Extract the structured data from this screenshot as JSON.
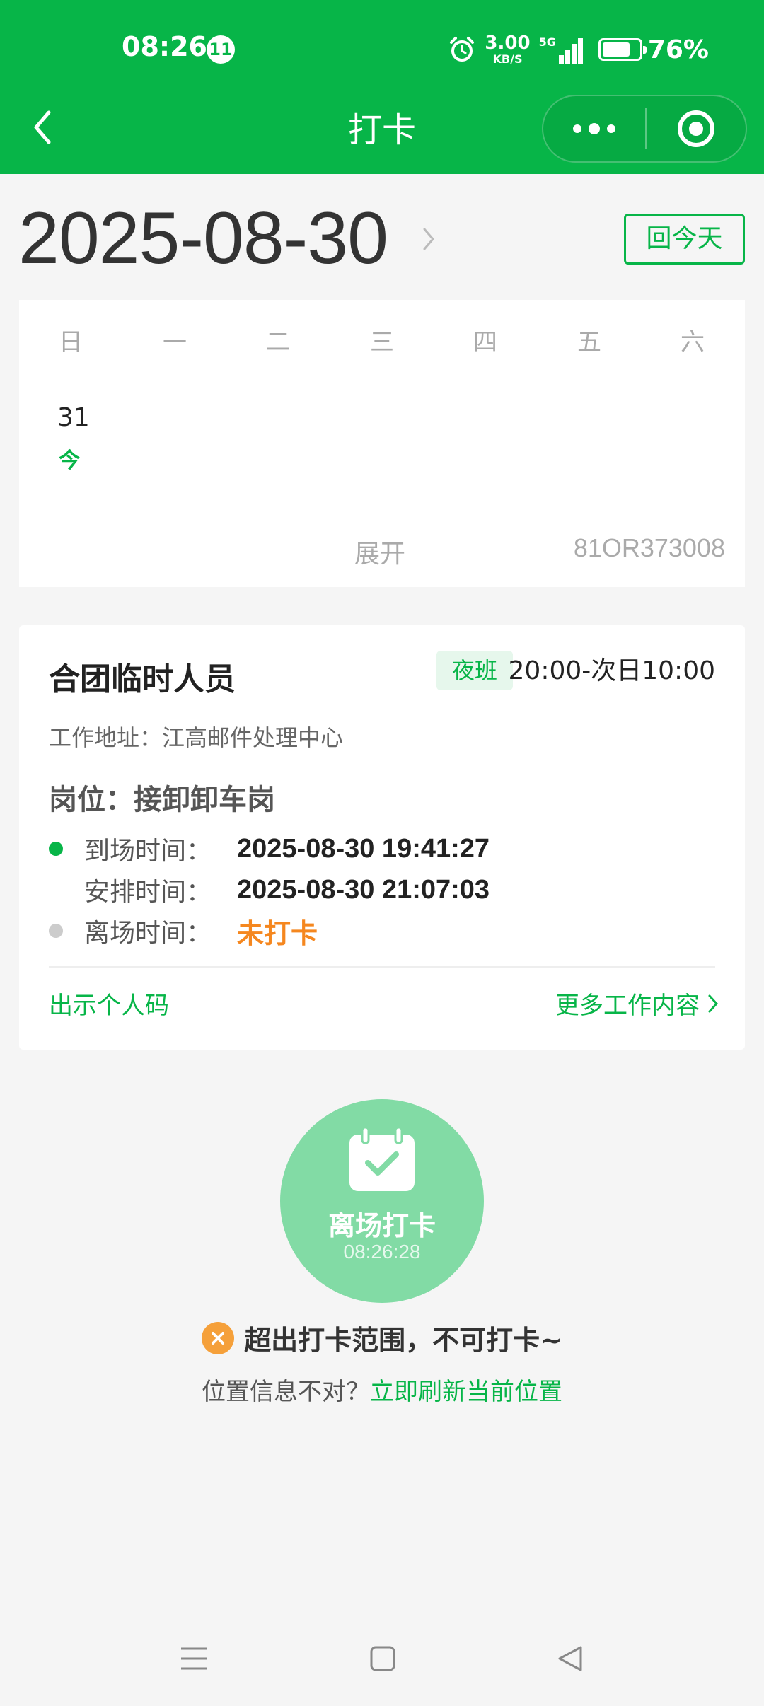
{
  "status_bar": {
    "time": "08:26",
    "notification_count": "11",
    "net_speed_value": "3.00",
    "net_speed_unit": "KB/S",
    "network_type": "5G",
    "battery_percent": "76%",
    "battery_level": 0.76
  },
  "nav": {
    "title": "打卡"
  },
  "date_header": {
    "date": "2025-08-30",
    "today_button": "回今天"
  },
  "calendar": {
    "weekdays": [
      "日",
      "一",
      "二",
      "三",
      "四",
      "五",
      "六"
    ],
    "day_number": "31",
    "today_label": "今",
    "expand_label": "展开",
    "station_code": "81OR373008"
  },
  "work_card": {
    "title": "合团临时人员",
    "shift_tag": "夜班",
    "shift_time": "20:00-次日10:00",
    "address": "工作地址：江高邮件处理中心",
    "position": "岗位：接卸卸车岗",
    "arrival_label": "到场时间：",
    "arrival_value": "2025-08-30 19:41:27",
    "schedule_label": "安排时间：",
    "schedule_value": "2025-08-30 21:07:03",
    "leave_label": "离场时间：",
    "leave_value": "未打卡",
    "show_code_link": "出示个人码",
    "more_work_link": "更多工作内容"
  },
  "punch": {
    "label": "离场打卡",
    "time": "08:26:28",
    "warning": "超出打卡范围，不可打卡~",
    "location_question": "位置信息不对？",
    "refresh_link": "立即刷新当前位置"
  },
  "colors": {
    "brand": "#07b548",
    "punch_button": "#82dba5",
    "warning": "#f5871f",
    "error_icon": "#f5a03a"
  }
}
